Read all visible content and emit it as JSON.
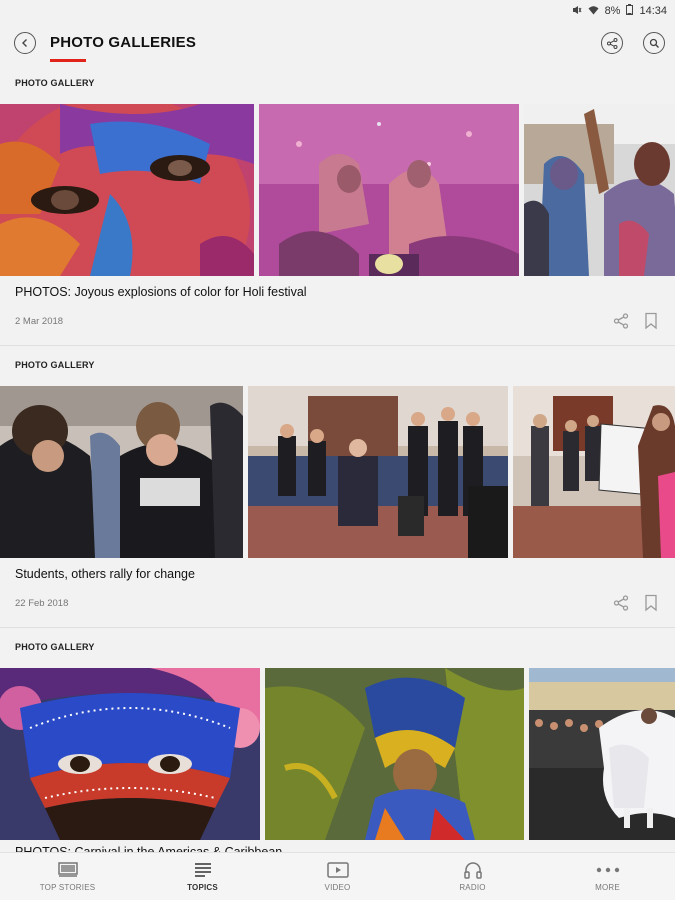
{
  "status_bar": {
    "time": "14:34",
    "battery": "8%"
  },
  "header": {
    "title": "PHOTO GALLERIES",
    "accent": "#e2231a"
  },
  "galleries": [
    {
      "label": "PHOTO GALLERY",
      "title": "PHOTOS: Joyous explosions of color for Holi festival",
      "date": "2 Mar 2018"
    },
    {
      "label": "PHOTO GALLERY",
      "title": "Students, others rally for change",
      "date": "22 Feb 2018"
    },
    {
      "label": "PHOTO GALLERY",
      "title": "PHOTOS: Carnival in the Americas & Caribbean"
    }
  ],
  "bottom_nav": [
    {
      "label": "TOP STORIES",
      "icon": "top-stories-icon"
    },
    {
      "label": "TOPICS",
      "icon": "topics-icon",
      "active": true
    },
    {
      "label": "VIDEO",
      "icon": "video-icon"
    },
    {
      "label": "RADIO",
      "icon": "headphones-icon"
    },
    {
      "label": "MORE",
      "icon": "more-icon"
    }
  ]
}
